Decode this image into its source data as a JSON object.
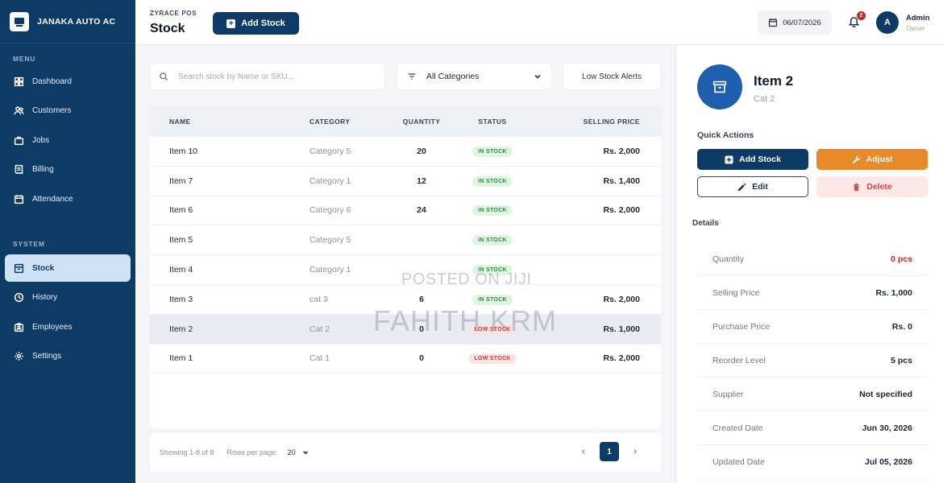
{
  "brand": {
    "name": "JANAKA AUTO AC"
  },
  "sidebar": {
    "menu_label": "MENU",
    "menu_items": [
      {
        "label": "Dashboard",
        "icon": "dashboard-icon"
      },
      {
        "label": "Customers",
        "icon": "users-icon"
      },
      {
        "label": "Jobs",
        "icon": "briefcase-icon"
      },
      {
        "label": "Billing",
        "icon": "receipt-icon"
      },
      {
        "label": "Attendance",
        "icon": "calendar-icon"
      }
    ],
    "system_label": "SYSTEM",
    "system_items": [
      {
        "label": "Stock",
        "icon": "stock-icon",
        "active": true
      },
      {
        "label": "History",
        "icon": "history-icon"
      },
      {
        "label": "Employees",
        "icon": "employees-icon"
      },
      {
        "label": "Settings",
        "icon": "gear-icon"
      }
    ]
  },
  "header": {
    "app_name": "ZYRACE POS",
    "title": "Stock",
    "add_stock_label": "Add Stock",
    "date": "06/07/2026",
    "notification_count": "2",
    "user_initial": "A",
    "user_name": "Admin",
    "user_role": "Owner"
  },
  "filters": {
    "search_placeholder": "Search stock by Name or SKU...",
    "category_selected": "All Categories",
    "low_stock_label": "Low Stock Alerts"
  },
  "table": {
    "columns": [
      "NAME",
      "CATEGORY",
      "QUANTITY",
      "STATUS",
      "SELLING PRICE"
    ],
    "rows": [
      {
        "name": "Item 10",
        "category": "Category 5",
        "quantity": "20",
        "status": "IN STOCK",
        "price": "Rs. 2,000"
      },
      {
        "name": "Item 7",
        "category": "Category 1",
        "quantity": "12",
        "status": "IN STOCK",
        "price": "Rs. 1,400"
      },
      {
        "name": "Item 6",
        "category": "Category 6",
        "quantity": "24",
        "status": "IN STOCK",
        "price": "Rs. 2,000"
      },
      {
        "name": "Item 5",
        "category": "Category 5",
        "quantity": "",
        "status": "IN STOCK",
        "price": ""
      },
      {
        "name": "Item 4",
        "category": "Category 1",
        "quantity": "",
        "status": "IN STOCK",
        "price": ""
      },
      {
        "name": "Item 3",
        "category": "cat 3",
        "quantity": "6",
        "status": "IN STOCK",
        "price": "Rs. 2,000"
      },
      {
        "name": "Item 2",
        "category": "Cat 2",
        "quantity": "0",
        "status": "LOW STOCK",
        "price": "Rs. 1,000"
      },
      {
        "name": "Item 1",
        "category": "Cat 1",
        "quantity": "0",
        "status": "LOW STOCK",
        "price": "Rs. 2,000"
      }
    ]
  },
  "footer": {
    "showing": "Showing 1-8 of 8",
    "rows_per_page_label": "Rows per page:",
    "rows_per_page": "20",
    "current_page": "1"
  },
  "detail": {
    "title": "Item 2",
    "category": "Cat 2",
    "quick_actions_label": "Quick Actions",
    "add_stock": "Add Stock",
    "adjust": "Adjust",
    "edit": "Edit",
    "delete": "Delete",
    "details_label": "Details",
    "fields": [
      {
        "label": "Quantity",
        "value": "0 pcs"
      },
      {
        "label": "Selling Price",
        "value": "Rs. 1,000"
      },
      {
        "label": "Purchase Price",
        "value": "Rs. 0"
      },
      {
        "label": "Reorder Level",
        "value": "5 pcs"
      },
      {
        "label": "Supplier",
        "value": "Not specified"
      },
      {
        "label": "Created Date",
        "value": "Jun 30, 2026"
      },
      {
        "label": "Updated Date",
        "value": "Jul 05, 2026"
      }
    ]
  },
  "watermark": {
    "line1": "POSTED ON JIJI",
    "line2": "FAHITH KRM"
  },
  "colors": {
    "sidebar": "#0e3a66",
    "accent": "#0e3a66",
    "active_nav": "#cfe3f6",
    "in_stock": "#2e8a3e",
    "low_stock": "#cc3a3a",
    "adjust": "#e8892a",
    "delete_bg": "#fde8e8",
    "item_avatar": "#1f5fb0"
  }
}
